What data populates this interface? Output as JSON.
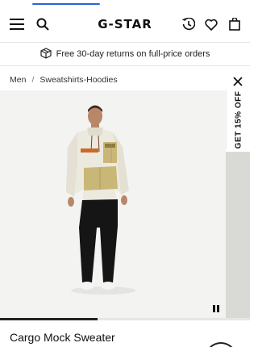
{
  "brand": {
    "logo": "G-STAR"
  },
  "header": {
    "menu_icon": "hamburger-menu-icon",
    "search_icon": "search-icon",
    "history_icon": "history-icon",
    "wishlist_icon": "heart-icon",
    "bag_icon": "shopping-bag-icon"
  },
  "promo": {
    "text": "Free 30-day returns on full-price orders",
    "icon": "box-icon"
  },
  "breadcrumb": {
    "items": [
      "Men",
      "Sweatshirts-Hoodies"
    ],
    "separator": "/"
  },
  "side_promo": {
    "label": "GET 15% OFF",
    "close_icon": "close-icon"
  },
  "gallery": {
    "pause_icon": "pause-icon",
    "progress_fraction": 0.39
  },
  "product": {
    "title": "Cargo Mock Sweater"
  },
  "colors": {
    "accent": "#2b63d9",
    "text": "#111111",
    "hero_bg": "#f3f3f1",
    "sweater": "#ece9df",
    "panel": "#c9b778",
    "pants": "#151515"
  }
}
